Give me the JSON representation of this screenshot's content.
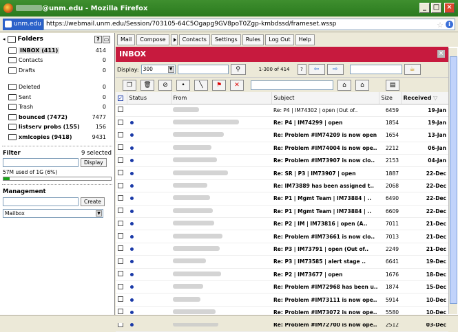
{
  "window": {
    "title_suffix": "@unm.edu - Mozilla Firefox",
    "min": "_",
    "max": "□",
    "close": "×"
  },
  "urlbar": {
    "site": "unm.edu",
    "url": "https://webmail.unm.edu/Session/703105-64C5Ogapg9GV8poT0Zgp-kmbdssd/frameset.wssp"
  },
  "folders": {
    "title": "Folders",
    "items": [
      {
        "name": "INBOX (411)",
        "count": "414",
        "bold": true
      },
      {
        "name": "Contacts",
        "count": "0"
      },
      {
        "name": "Drafts",
        "count": "0"
      },
      {
        "name": "Deleted",
        "count": "0"
      },
      {
        "name": "Sent",
        "count": "0"
      },
      {
        "name": "Trash",
        "count": "0"
      },
      {
        "name": "bounced (7472)",
        "count": "7477",
        "bold": true
      },
      {
        "name": "listserv probs (155)",
        "count": "156",
        "bold": true
      },
      {
        "name": "xmlcopies (9418)",
        "count": "9431",
        "bold": true
      }
    ]
  },
  "filter": {
    "label": "Filter",
    "selected": "9 selected",
    "button": "Display",
    "quota": "57M used of 1G  (6%)",
    "quota_fraction": 0.06
  },
  "management": {
    "label": "Management",
    "button": "Create",
    "select": "Mailbox"
  },
  "nav": {
    "mail": "Mail",
    "compose": "Compose",
    "contacts": "Contacts",
    "settings": "Settings",
    "rules": "Rules",
    "logout": "Log Out",
    "help": "Help"
  },
  "inbox": {
    "title": "INBOX",
    "display_label": "Display:",
    "display_value": "300",
    "range": "1-300 of 414",
    "help": "?"
  },
  "columns": {
    "status": "Status",
    "from": "From",
    "subject": "Subject",
    "size": "Size",
    "received": "Received"
  },
  "messages": [
    {
      "subject": "Re: P4 | IM74302 | open (Out of..",
      "size": "6459",
      "date": "19-Jan",
      "bold": false,
      "dot": false
    },
    {
      "subject": "Re: P4 | IM74299 | open",
      "size": "1854",
      "date": "19-Jan",
      "bold": true,
      "dot": true
    },
    {
      "subject": "Re: Problem #IM74209 is now open",
      "size": "1654",
      "date": "13-Jan",
      "bold": true,
      "dot": true
    },
    {
      "subject": "Re: Problem #IM74004 is now ope..",
      "size": "2212",
      "date": "06-Jan",
      "bold": true,
      "dot": true
    },
    {
      "subject": "Re: Problem #IM73907 is now clo..",
      "size": "2153",
      "date": "04-Jan",
      "bold": true,
      "dot": true
    },
    {
      "subject": "Re: SR | P3 | IM73907 | open",
      "size": "1887",
      "date": "22-Dec",
      "bold": true,
      "dot": true
    },
    {
      "subject": "Re: IM73889 has been assigned t..",
      "size": "2068",
      "date": "22-Dec",
      "bold": true,
      "dot": true
    },
    {
      "subject": "Re: P1 | Mgmt Team | IM73884 | ..",
      "size": "6490",
      "date": "22-Dec",
      "bold": true,
      "dot": true
    },
    {
      "subject": "Re: P1 | Mgmt Team | IM73884 | ..",
      "size": "6609",
      "date": "22-Dec",
      "bold": true,
      "dot": true
    },
    {
      "subject": "Re: P2 | IM | IM73816 | open (A..",
      "size": "7011",
      "date": "21-Dec",
      "bold": true,
      "dot": true
    },
    {
      "subject": "Re: Problem #IM73661 is now clo..",
      "size": "7013",
      "date": "21-Dec",
      "bold": true,
      "dot": true
    },
    {
      "subject": "Re: P3 | IM73791 | open (Out of..",
      "size": "2249",
      "date": "21-Dec",
      "bold": true,
      "dot": true
    },
    {
      "subject": "Re: P3 | IM73585 | alert stage ..",
      "size": "6641",
      "date": "19-Dec",
      "bold": true,
      "dot": true
    },
    {
      "subject": "Re: P2 | IM73677 | open",
      "size": "1676",
      "date": "18-Dec",
      "bold": true,
      "dot": true
    },
    {
      "subject": "Re: Problem #IM72968 has been u..",
      "size": "1874",
      "date": "15-Dec",
      "bold": true,
      "dot": true
    },
    {
      "subject": "Re: Problem #IM73111 is now ope..",
      "size": "5914",
      "date": "10-Dec",
      "bold": true,
      "dot": true
    },
    {
      "subject": "Re: Problem #IM73072 is now ope..",
      "size": "5580",
      "date": "10-Dec",
      "bold": true,
      "dot": true
    },
    {
      "subject": "Re: Problem #IM72700 is now ope..",
      "size": "2512",
      "date": "03-Dec",
      "bold": true,
      "dot": true
    }
  ]
}
